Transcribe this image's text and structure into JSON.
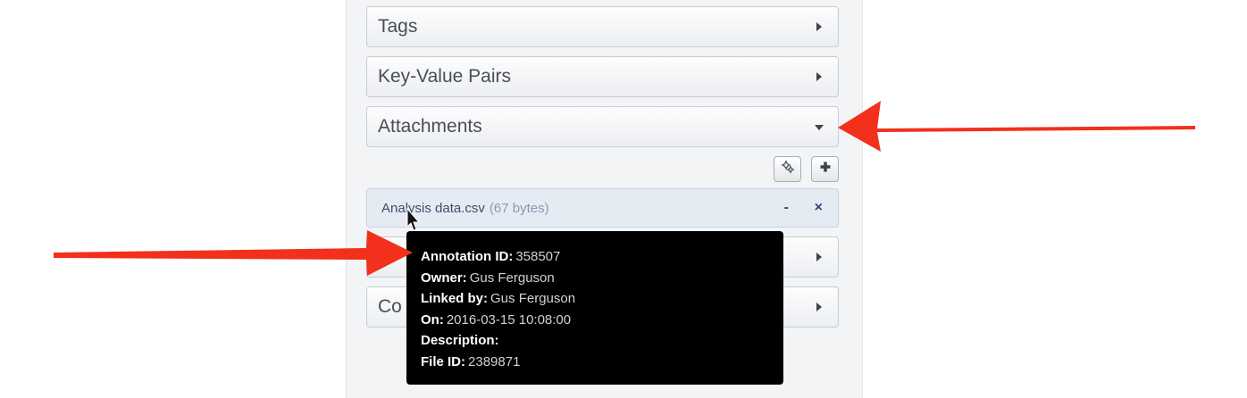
{
  "panel": {
    "sections": {
      "tags": {
        "label": "Tags"
      },
      "key_value_pairs": {
        "label": "Key-Value Pairs"
      },
      "attachments": {
        "label": "Attachments"
      },
      "collapsed_row_1": {
        "label": ""
      },
      "collapsed_row_2": {
        "label": "Co"
      }
    },
    "attachment_toolbar": {
      "settings_icon": "gears-icon",
      "add_icon": "plus-icon"
    },
    "attachment": {
      "name": "Analysis data.csv",
      "size": "(67 bytes)",
      "minus_label": "-",
      "remove_label": "×"
    }
  },
  "tooltip": {
    "annotation_id": {
      "label": "Annotation ID:",
      "value": "358507"
    },
    "owner": {
      "label": "Owner:",
      "value": "Gus Ferguson"
    },
    "linked_by": {
      "label": "Linked by:",
      "value": "Gus Ferguson"
    },
    "on": {
      "label": "On:",
      "value": "2016-03-15 10:08:00"
    },
    "description": {
      "label": "Description:",
      "value": ""
    },
    "file_id": {
      "label": "File ID:",
      "value": "2389871"
    }
  },
  "annotations": {
    "arrow_color": "#f2301b",
    "arrow_count": 2
  },
  "colors": {
    "panel_bg": "#f3f4f6",
    "attachment_row_bg": "#e5ebf3",
    "tooltip_bg": "#000000"
  }
}
